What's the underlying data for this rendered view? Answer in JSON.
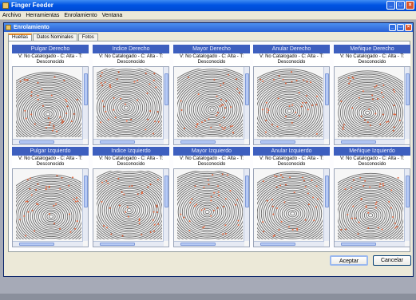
{
  "app": {
    "title": "Finger Feeder"
  },
  "menu": [
    "Archivo",
    "Herramientas",
    "Enrolamiento",
    "Ventana"
  ],
  "window": {
    "title": "Enrolamiento"
  },
  "tabs": [
    "Huellas",
    "Datos Nominales",
    "Fotos"
  ],
  "status_line1": "V: No Catalogado - C: Alta - T:",
  "status_line2": "Desconocido",
  "fingers": [
    "Pulgar Derecho",
    "Indice Derecho",
    "Mayor Derecho",
    "Anular Derecho",
    "Meñique Derecho",
    "Pulgar Izquierdo",
    "Indice Izquierdo",
    "Mayor Izquierdo",
    "Anular Izquierdo",
    "Meñique Izquierdo"
  ],
  "buttons": {
    "accept": "Aceptar",
    "cancel": "Cancelar"
  },
  "colors": {
    "header": "#3d5fbf",
    "titlebar": "#0054e3",
    "minutiae": "#e0643c"
  }
}
